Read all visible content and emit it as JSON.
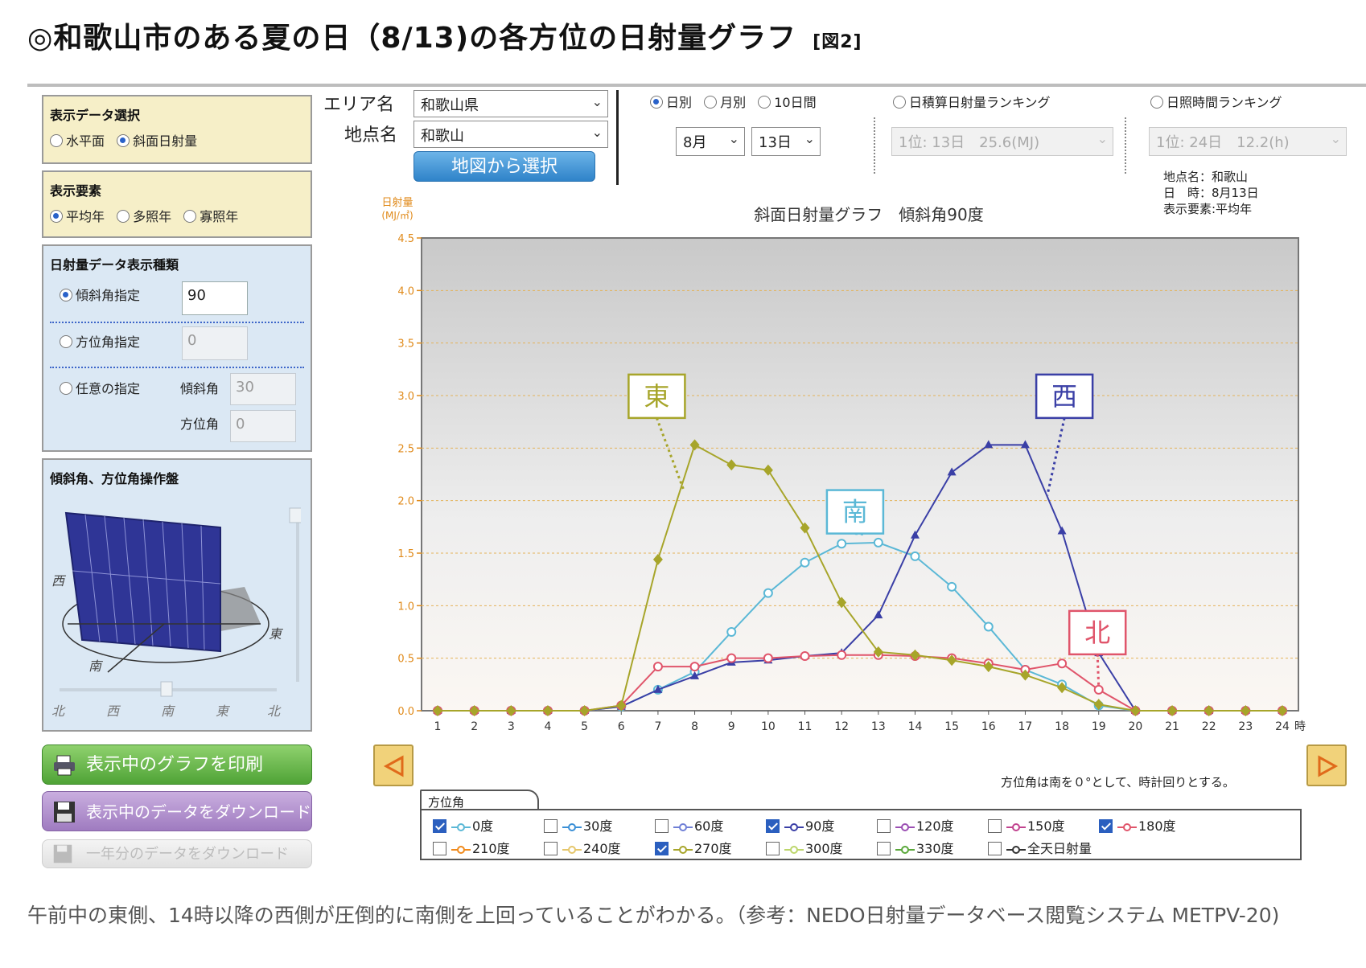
{
  "title": "◎和歌山市のある夏の日（8/13)の各方位の日射量グラフ",
  "figure_label": "[図2]",
  "panels": {
    "data_select": {
      "title": "表示データ選択",
      "options": [
        {
          "label": "水平面",
          "selected": false
        },
        {
          "label": "斜面日射量",
          "selected": true
        }
      ]
    },
    "elements": {
      "title": "表示要素",
      "options": [
        {
          "label": "平均年",
          "selected": true
        },
        {
          "label": "多照年",
          "selected": false
        },
        {
          "label": "寡照年",
          "selected": false
        }
      ]
    },
    "types": {
      "title": "日射量データ表示種類",
      "tilt_label": "傾斜角指定",
      "tilt_value": "90",
      "azimuth_label": "方位角指定",
      "azimuth_value": "0",
      "custom_label": "任意の指定",
      "custom_tilt_label": "傾斜角",
      "custom_tilt_value": "30",
      "custom_azimuth_label": "方位角",
      "custom_azimuth_value": "0"
    },
    "operation": {
      "title": "傾斜角、方位角操作盤",
      "west": "西",
      "east": "東",
      "south": "南",
      "scale_labels": [
        "北",
        "西",
        "南",
        "東",
        "北"
      ]
    }
  },
  "buttons": {
    "print": "表示中のグラフを印刷",
    "download": "表示中のデータをダウンロード",
    "download_year": "一年分のデータをダウンロード",
    "map_select": "地図から選択"
  },
  "area": {
    "area_label": "エリア名",
    "area_value": "和歌山県",
    "point_label": "地点名",
    "point_value": "和歌山"
  },
  "period": {
    "options": [
      {
        "label": "日別",
        "selected": true
      },
      {
        "label": "月別",
        "selected": false
      },
      {
        "label": "10日間",
        "selected": false
      }
    ],
    "month": "8月",
    "day": "13日"
  },
  "ranking1": {
    "label": "日積算日射量ランキング",
    "value": "1位: 13日　25.6(MJ)"
  },
  "ranking2": {
    "label": "日照時間ランキング",
    "value": "1位: 24日　12.2(h)"
  },
  "info": {
    "point": "地点名：和歌山",
    "date": "日　時：8月13日",
    "element": "表示要素:平均年"
  },
  "chart_data": {
    "type": "line",
    "title": "斜面日射量グラフ　傾斜角90度",
    "ylabel": "日射量",
    "yunit": "(MJ/㎡)",
    "xunit": "時",
    "x": [
      1,
      2,
      3,
      4,
      5,
      6,
      7,
      8,
      9,
      10,
      11,
      12,
      13,
      14,
      15,
      16,
      17,
      18,
      19,
      20,
      21,
      22,
      23,
      24
    ],
    "ylim": [
      0,
      4.5
    ],
    "yticks": [
      "0.0",
      "0.5",
      "1.0",
      "1.5",
      "2.0",
      "2.5",
      "3.0",
      "3.5",
      "4.0",
      "4.5"
    ],
    "series": [
      {
        "name": "0度",
        "color": "#5bb8d6",
        "marker": "circle-open",
        "values": [
          0,
          0,
          0,
          0,
          0,
          0.04,
          0.2,
          0.37,
          0.75,
          1.12,
          1.41,
          1.59,
          1.6,
          1.47,
          1.18,
          0.8,
          0.39,
          0.25,
          0.05,
          0,
          0,
          0,
          0,
          0
        ]
      },
      {
        "name": "90度",
        "color": "#3a3fa6",
        "marker": "triangle",
        "values": [
          0,
          0,
          0,
          0,
          0,
          0.04,
          0.2,
          0.33,
          0.46,
          0.48,
          0.52,
          0.55,
          0.91,
          1.67,
          2.27,
          2.53,
          2.53,
          1.71,
          0.55,
          0,
          0,
          0,
          0,
          0
        ]
      },
      {
        "name": "180度",
        "color": "#e0556b",
        "marker": "circle-open",
        "values": [
          0,
          0,
          0,
          0,
          0,
          0.05,
          0.42,
          0.42,
          0.5,
          0.5,
          0.52,
          0.53,
          0.53,
          0.52,
          0.5,
          0.45,
          0.39,
          0.45,
          0.2,
          0,
          0,
          0,
          0,
          0
        ]
      },
      {
        "name": "270度",
        "color": "#a7a52a",
        "marker": "diamond",
        "values": [
          0,
          0,
          0,
          0,
          0,
          0.05,
          1.44,
          2.53,
          2.34,
          2.29,
          1.74,
          1.03,
          0.56,
          0.53,
          0.48,
          0.42,
          0.34,
          0.22,
          0.06,
          0,
          0,
          0,
          0,
          0
        ]
      }
    ],
    "annotations": [
      {
        "text": "東",
        "color": "#a7a52a"
      },
      {
        "text": "南",
        "color": "#5bb8d6"
      },
      {
        "text": "西",
        "color": "#3a3fa6"
      },
      {
        "text": "北",
        "color": "#e0556b"
      }
    ],
    "grid": true
  },
  "legend": {
    "tab": "方位角",
    "items": [
      {
        "label": "0度",
        "checked": true,
        "color": "#5bb8d6"
      },
      {
        "label": "30度",
        "checked": false,
        "color": "#3a8fd6"
      },
      {
        "label": "60度",
        "checked": false,
        "color": "#6f7fd6"
      },
      {
        "label": "90度",
        "checked": true,
        "color": "#3a3fa6"
      },
      {
        "label": "120度",
        "checked": false,
        "color": "#9b4fb3"
      },
      {
        "label": "150度",
        "checked": false,
        "color": "#c1438f"
      },
      {
        "label": "180度",
        "checked": true,
        "color": "#e0556b"
      },
      {
        "label": "210度",
        "checked": false,
        "color": "#f08a1c"
      },
      {
        "label": "240度",
        "checked": false,
        "color": "#e5c66b"
      },
      {
        "label": "270度",
        "checked": true,
        "color": "#a7a52a"
      },
      {
        "label": "300度",
        "checked": false,
        "color": "#bcd66b"
      },
      {
        "label": "330度",
        "checked": false,
        "color": "#5aa83a"
      },
      {
        "label": "全天日射量",
        "checked": false,
        "color": "#333333"
      }
    ]
  },
  "azimuth_note": "方位角は南を０°として、時計回りとする。",
  "caption": "午前中の東側、14時以降の西側が圧倒的に南側を上回っていることがわかる。（参考：NEDO日射量データベース閲覧システム METPV-20)"
}
